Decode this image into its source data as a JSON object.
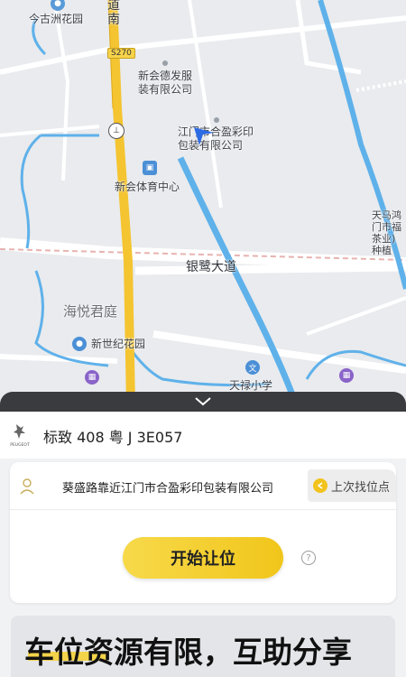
{
  "map": {
    "labels": {
      "garden_north": "今古洲花园",
      "road_nan": "道\n南",
      "route": "S270",
      "factory": "新会德发服\n装有限公司",
      "company": "江门市合盈彩印\n包装有限公司",
      "sports_center": "新会体育中心",
      "avenue": "银鹭大道",
      "haiyue": "海悦君庭",
      "xinshiji": "新世纪花园",
      "tianlu": "天禄小学",
      "tianma": "天马鸿\n门市福\n茶业)\n种植"
    },
    "icons": [
      "location-pin-icon",
      "police-icon",
      "navigation-arrow-icon",
      "school-icon"
    ]
  },
  "sheet": {
    "vehicle": {
      "brand_logo_text": "PEUGEOT",
      "plate": "标致 408 粤 J 3E057"
    },
    "location": {
      "text": "葵盛路靠近江门市合盈彩印包装有限公司",
      "last_btn": "上次找位点"
    },
    "start_btn": "开始让位",
    "help_icon": "?",
    "banner": "车位资源有限，互助分享"
  },
  "colors": {
    "accent_yellow": "#f2c61c",
    "water": "#5fb1ea",
    "road_main": "#f4c431"
  }
}
